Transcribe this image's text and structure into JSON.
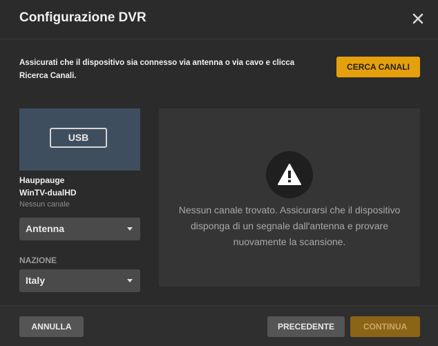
{
  "dialog": {
    "title": "Configurazione DVR",
    "close_icon": "close-icon"
  },
  "intro": {
    "text": "Assicurati che il dispositivo sia connesso via antenna o via cavo e clicca Ricerca Canali.",
    "scan_button": "CERCA CANALI"
  },
  "device": {
    "badge": "USB",
    "name_line1": "Hauppauge",
    "name_line2": "WinTV-dualHD",
    "status": "Nessun canale",
    "source_select": "Antenna",
    "nation_label": "NAZIONE",
    "nation_select": "Italy"
  },
  "result": {
    "icon": "warning-icon",
    "message": "Nessun canale trovato. Assicurarsi che il dispositivo disponga di un segnale dall'antenna e provare nuovamente la scansione."
  },
  "footer": {
    "cancel": "ANNULLA",
    "previous": "PRECEDENTE",
    "continue": "CONTINUA"
  },
  "colors": {
    "accent": "#e5a00d",
    "background": "#2b2b2b",
    "panel": "#353535",
    "device_card": "#3e4e5e"
  }
}
